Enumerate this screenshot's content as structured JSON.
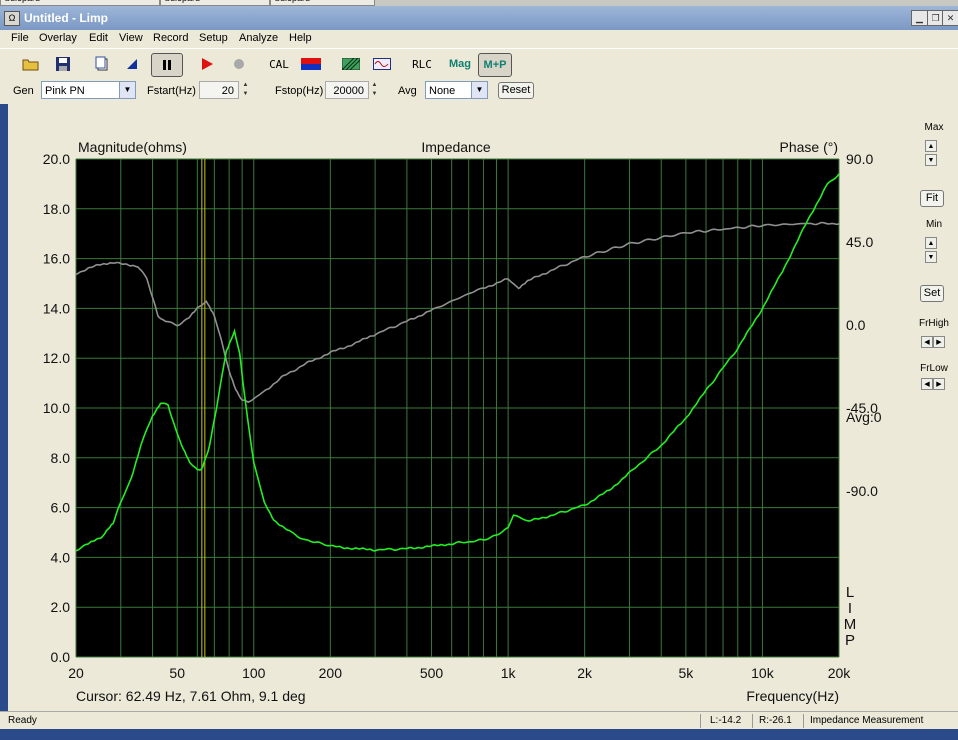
{
  "taskbar": {
    "items": [
      "bdlepard",
      "bdlepard",
      "bdlepard"
    ]
  },
  "window": {
    "title": "Untitled - Limp",
    "icon_name": "limp-app-icon"
  },
  "menu": [
    "File",
    "Overlay",
    "Edit",
    "View",
    "Record",
    "Setup",
    "Analyze",
    "Help"
  ],
  "toolbar": {
    "cal_label": "CAL",
    "rlc_label": "RLC",
    "mag_label": "Mag",
    "mp_label": "M+P"
  },
  "controls": {
    "gen_label": "Gen",
    "gen_value": "Pink PN",
    "fstart_label": "Fstart(Hz)",
    "fstart_value": "20",
    "fstop_label": "Fstop(Hz)",
    "fstop_value": "20000",
    "avg_label": "Avg",
    "avg_value": "None",
    "reset_label": "Reset"
  },
  "right_panel": {
    "max_label": "Max",
    "fit_label": "Fit",
    "min_label": "Min",
    "set_label": "Set",
    "frhigh_label": "FrHigh",
    "frlow_label": "FrLow"
  },
  "status": {
    "ready": "Ready",
    "left": "L:-14.2",
    "right": "R:-26.1",
    "mode": "Impedance Measurement"
  },
  "colors": {
    "plot_bg": "#000000",
    "grid": "#3a7a3a",
    "magnitude": "#22ee22",
    "phase": "#909090",
    "cursor": "#c8c820"
  },
  "chart_data": {
    "type": "line",
    "title": "Impedance",
    "ylabel": "Magnitude(ohms)",
    "y2label": "Phase (°)",
    "xlabel": "Frequency(Hz)",
    "xscale": "log",
    "xlim": [
      20,
      20000
    ],
    "ylim": [
      0,
      20
    ],
    "y2lim": [
      -180,
      90
    ],
    "xticks": [
      20,
      50,
      100,
      200,
      500,
      1000,
      2000,
      5000,
      10000,
      20000
    ],
    "xtick_labels": [
      "20",
      "50",
      "100",
      "200",
      "500",
      "1k",
      "2k",
      "5k",
      "10k",
      "20k"
    ],
    "yticks": [
      0,
      2,
      4,
      6,
      8,
      10,
      12,
      14,
      16,
      18,
      20
    ],
    "ytick_labels": [
      "0.0",
      "2.0",
      "4.0",
      "6.0",
      "8.0",
      "10.0",
      "12.0",
      "14.0",
      "16.0",
      "18.0",
      "20.0"
    ],
    "y2ticks": [
      90,
      45,
      0,
      -45,
      -90
    ],
    "y2tick_labels": [
      "90.0",
      "45.0",
      "0.0",
      "-45.0",
      "-90.0"
    ],
    "avg_label": "Avg:0",
    "watermark": "LIMP",
    "cursor_x": 62.49,
    "cursor_text": "Cursor: 62.49 Hz, 7.61 Ohm, 9.1 deg",
    "grid": true,
    "series": [
      {
        "x": [
          20,
          22,
          25,
          26,
          28,
          30,
          33,
          36,
          40,
          43,
          46,
          48,
          52,
          56,
          60,
          63,
          67,
          72,
          78,
          84,
          88,
          92,
          100,
          110,
          120,
          140,
          160,
          180,
          200,
          250,
          300,
          400,
          500,
          600,
          800,
          900,
          1000,
          1050,
          1200,
          1500,
          2000,
          2500,
          3000,
          4000,
          5000,
          6000,
          8000,
          10000,
          12000,
          15000,
          18000,
          20000
        ],
        "values": [
          4.3,
          4.5,
          4.8,
          5.0,
          5.4,
          6.2,
          7.2,
          8.5,
          9.7,
          10.2,
          10.1,
          9.5,
          8.5,
          7.8,
          7.5,
          7.6,
          8.5,
          10.2,
          12.3,
          13.1,
          12.2,
          10.5,
          7.8,
          6.2,
          5.5,
          5.0,
          4.7,
          4.6,
          4.45,
          4.35,
          4.3,
          4.35,
          4.45,
          4.55,
          4.7,
          4.9,
          5.2,
          5.7,
          5.45,
          5.7,
          6.1,
          6.7,
          7.4,
          8.5,
          9.6,
          10.7,
          12.4,
          14.0,
          15.5,
          17.5,
          19.0,
          19.4
        ]
      },
      {
        "x": [
          20,
          25,
          28,
          30,
          35,
          38,
          40,
          42,
          45,
          50,
          55,
          60,
          65,
          70,
          75,
          80,
          85,
          90,
          95,
          100,
          110,
          130,
          160,
          200,
          250,
          300,
          400,
          500,
          700,
          800,
          1000,
          1100,
          1200,
          1500,
          2000,
          3000,
          5000,
          10000,
          15000,
          20000
        ],
        "values": [
          28,
          33,
          34,
          33,
          32,
          25,
          15,
          5,
          2,
          0,
          3,
          9,
          13,
          5,
          -10,
          -25,
          -35,
          -41,
          -42,
          -40,
          -36,
          -28,
          -21,
          -15,
          -10,
          -5,
          2,
          8,
          17,
          20,
          25,
          20,
          24,
          30,
          37,
          44,
          50,
          54,
          55,
          55
        ]
      }
    ]
  }
}
